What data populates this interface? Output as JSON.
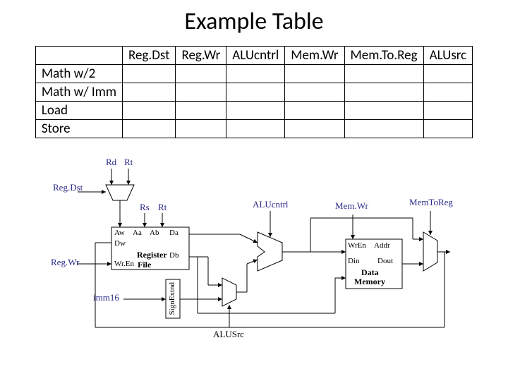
{
  "title": "Example Table",
  "table": {
    "columns": [
      "Reg.Dst",
      "Reg.Wr",
      "ALUcntrl",
      "Mem.Wr",
      "Mem.To.Reg",
      "ALUsrc"
    ],
    "rows": [
      "Math w/2",
      "Math w/ Imm",
      "Load",
      "Store"
    ]
  },
  "diagram": {
    "labels": {
      "rd": "Rd",
      "rt": "Rt",
      "regdst": "Reg.Dst",
      "rs": "Rs",
      "rt2": "Rt",
      "aw": "Aw",
      "aa": "Aa",
      "ab": "Ab",
      "da": "Da",
      "dw": "Dw",
      "db": "Db",
      "regwr": "Reg.Wr",
      "wren": "Wr.En",
      "regfile1": "Register",
      "regfile2": "File",
      "signext": "SignExtnd",
      "imm16": "imm16",
      "alucntrl": "ALUcntrl",
      "alusrc": "ALUSrc",
      "memwr": "Mem.Wr",
      "memtoreg": "MemToReg",
      "wren2": "WrEn",
      "addr": "Addr",
      "din": "Din",
      "dout": "Dout",
      "dmem1": "Data",
      "dmem2": "Memory"
    }
  }
}
